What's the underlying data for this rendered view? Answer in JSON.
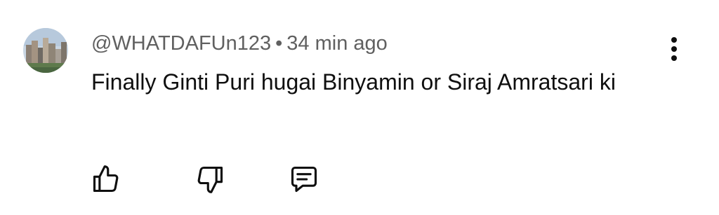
{
  "comment": {
    "author": "@WHATDAFUn123",
    "separator": "•",
    "time": "34 min ago",
    "text": "Finally Ginti Puri hugai Binyamin or Siraj Amratsari ki"
  },
  "icons": {
    "avatar": "city-skyline-avatar",
    "more": "more-vertical-icon",
    "like": "thumb-up-icon",
    "dislike": "thumb-down-icon",
    "reply": "comment-reply-icon"
  },
  "colors": {
    "text_primary": "#0f0f0f",
    "text_secondary": "#606060",
    "background": "#ffffff"
  }
}
